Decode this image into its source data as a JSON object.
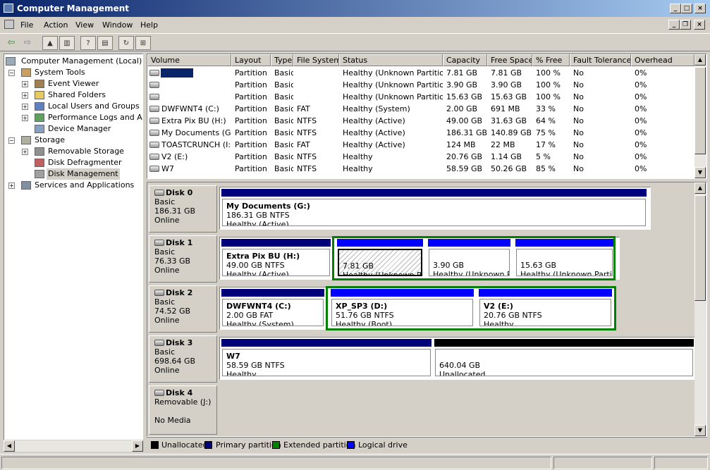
{
  "window": {
    "title": "Computer Management"
  },
  "menu": [
    "File",
    "Action",
    "View",
    "Window",
    "Help"
  ],
  "colors": {
    "primary": "#00007b",
    "extended": "#008000",
    "logical": "#0000ff",
    "unallocated": "#000000",
    "selection": "#d4d0c8"
  },
  "tree": {
    "root": "Computer Management (Local)",
    "system_tools": "System Tools",
    "event_viewer": "Event Viewer",
    "shared_folders": "Shared Folders",
    "local_users": "Local Users and Groups",
    "perf_logs": "Performance Logs and Alerts",
    "device_manager": "Device Manager",
    "storage": "Storage",
    "removable_storage": "Removable Storage",
    "disk_defrag": "Disk Defragmenter",
    "disk_management": "Disk Management",
    "services_apps": "Services and Applications"
  },
  "volume_list": {
    "columns": [
      "Volume",
      "Layout",
      "Type",
      "File System",
      "Status",
      "Capacity",
      "Free Space",
      "% Free",
      "Fault Tolerance",
      "Overhead"
    ],
    "rows": [
      [
        "",
        "Partition",
        "Basic",
        "",
        "Healthy (Unknown Partition)",
        "7.81 GB",
        "7.81 GB",
        "100 %",
        "No",
        "0%"
      ],
      [
        "",
        "Partition",
        "Basic",
        "",
        "Healthy (Unknown Partition)",
        "3.90 GB",
        "3.90 GB",
        "100 %",
        "No",
        "0%"
      ],
      [
        "",
        "Partition",
        "Basic",
        "",
        "Healthy (Unknown Partition)",
        "15.63 GB",
        "15.63 GB",
        "100 %",
        "No",
        "0%"
      ],
      [
        "DWFWNT4 (C:)",
        "Partition",
        "Basic",
        "FAT",
        "Healthy (System)",
        "2.00 GB",
        "691 MB",
        "33 %",
        "No",
        "0%"
      ],
      [
        "Extra Pix BU (H:)",
        "Partition",
        "Basic",
        "NTFS",
        "Healthy (Active)",
        "49.00 GB",
        "31.63 GB",
        "64 %",
        "No",
        "0%"
      ],
      [
        "My Documents (G:)",
        "Partition",
        "Basic",
        "NTFS",
        "Healthy (Active)",
        "186.31 GB",
        "140.89 GB",
        "75 %",
        "No",
        "0%"
      ],
      [
        "TOASTCRUNCH (I:)",
        "Partition",
        "Basic",
        "FAT",
        "Healthy (Active)",
        "124 MB",
        "22 MB",
        "17 %",
        "No",
        "0%"
      ],
      [
        "V2 (E:)",
        "Partition",
        "Basic",
        "NTFS",
        "Healthy",
        "20.76 GB",
        "1.14 GB",
        "5 %",
        "No",
        "0%"
      ],
      [
        "W7",
        "Partition",
        "Basic",
        "NTFS",
        "Healthy",
        "58.59 GB",
        "50.26 GB",
        "85 %",
        "No",
        "0%"
      ]
    ]
  },
  "disks": [
    {
      "name": "Disk 0",
      "type": "Basic",
      "size": "186.31 GB",
      "status": "Online",
      "partitions": [
        {
          "name": "My Documents  (G:)",
          "size": "186.31 GB NTFS",
          "status": "Healthy (Active)",
          "kind": "primary"
        }
      ]
    },
    {
      "name": "Disk 1",
      "type": "Basic",
      "size": "76.33 GB",
      "status": "Online",
      "partitions": [
        {
          "name": "Extra Pix BU  (H:)",
          "size": "49.00 GB NTFS",
          "status": "Healthy (Active)",
          "kind": "primary"
        },
        {
          "name": "",
          "size": "7.81 GB",
          "status": "Healthy (Unknown Parti",
          "kind": "logical-selected"
        },
        {
          "name": "",
          "size": "3.90 GB",
          "status": "Healthy (Unknown Par",
          "kind": "logical"
        },
        {
          "name": "",
          "size": "15.63 GB",
          "status": "Healthy (Unknown Partitio",
          "kind": "logical"
        }
      ]
    },
    {
      "name": "Disk 2",
      "type": "Basic",
      "size": "74.52 GB",
      "status": "Online",
      "partitions": [
        {
          "name": "DWFWNT4  (C:)",
          "size": "2.00 GB FAT",
          "status": "Healthy (System)",
          "kind": "primary"
        },
        {
          "name": "XP_SP3  (D:)",
          "size": "51.76 GB NTFS",
          "status": "Healthy (Boot)",
          "kind": "logical"
        },
        {
          "name": "V2  (E:)",
          "size": "20.76 GB NTFS",
          "status": "Healthy",
          "kind": "logical"
        }
      ]
    },
    {
      "name": "Disk 3",
      "type": "Basic",
      "size": "698.64 GB",
      "status": "Online",
      "partitions": [
        {
          "name": "W7",
          "size": "58.59 GB NTFS",
          "status": "Healthy",
          "kind": "primary"
        },
        {
          "name": "",
          "size": "640.04 GB",
          "status": "Unallocated",
          "kind": "unallocated"
        }
      ]
    },
    {
      "name": "Disk 4",
      "type": "Removable (J:)",
      "size": "",
      "status": "No Media",
      "partitions": []
    }
  ],
  "legend": [
    "Unallocated",
    "Primary partition",
    "Extended partition",
    "Logical drive"
  ]
}
